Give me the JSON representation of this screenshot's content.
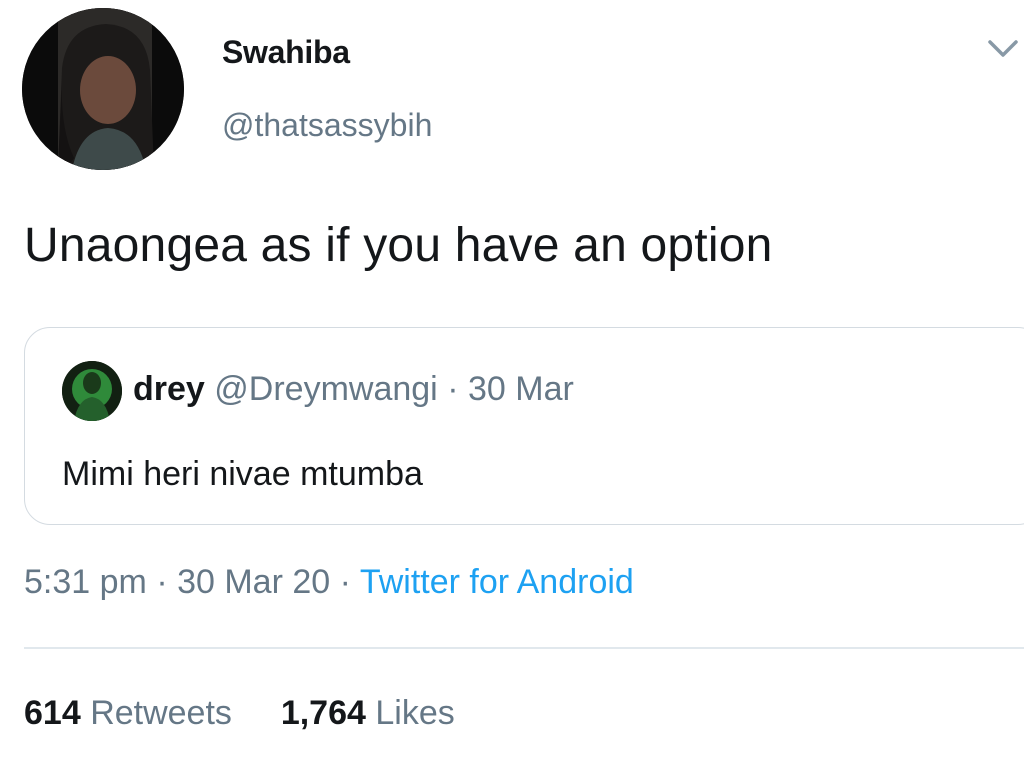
{
  "author": {
    "name": "Swahiba",
    "handle": "@thatsassybih"
  },
  "tweet": {
    "text": "Unaongea as if you have an option"
  },
  "quoted_tweet": {
    "name": "drey",
    "handle": "@Dreymwangi",
    "separator": "·",
    "date": "30 Mar",
    "text": "Mimi heri nivae mtumba"
  },
  "meta": {
    "time": "5:31 pm",
    "separator": "·",
    "date": "30 Mar 20",
    "source": "Twitter for Android"
  },
  "stats": {
    "retweets_count": "614",
    "retweets_label": "Retweets",
    "likes_count": "1,764",
    "likes_label": "Likes"
  },
  "icons": {
    "menu": "chevron-down-icon"
  },
  "colors": {
    "text_primary": "#14171a",
    "text_secondary": "#657786",
    "link": "#1da1f2",
    "border": "#d4dbe1"
  }
}
